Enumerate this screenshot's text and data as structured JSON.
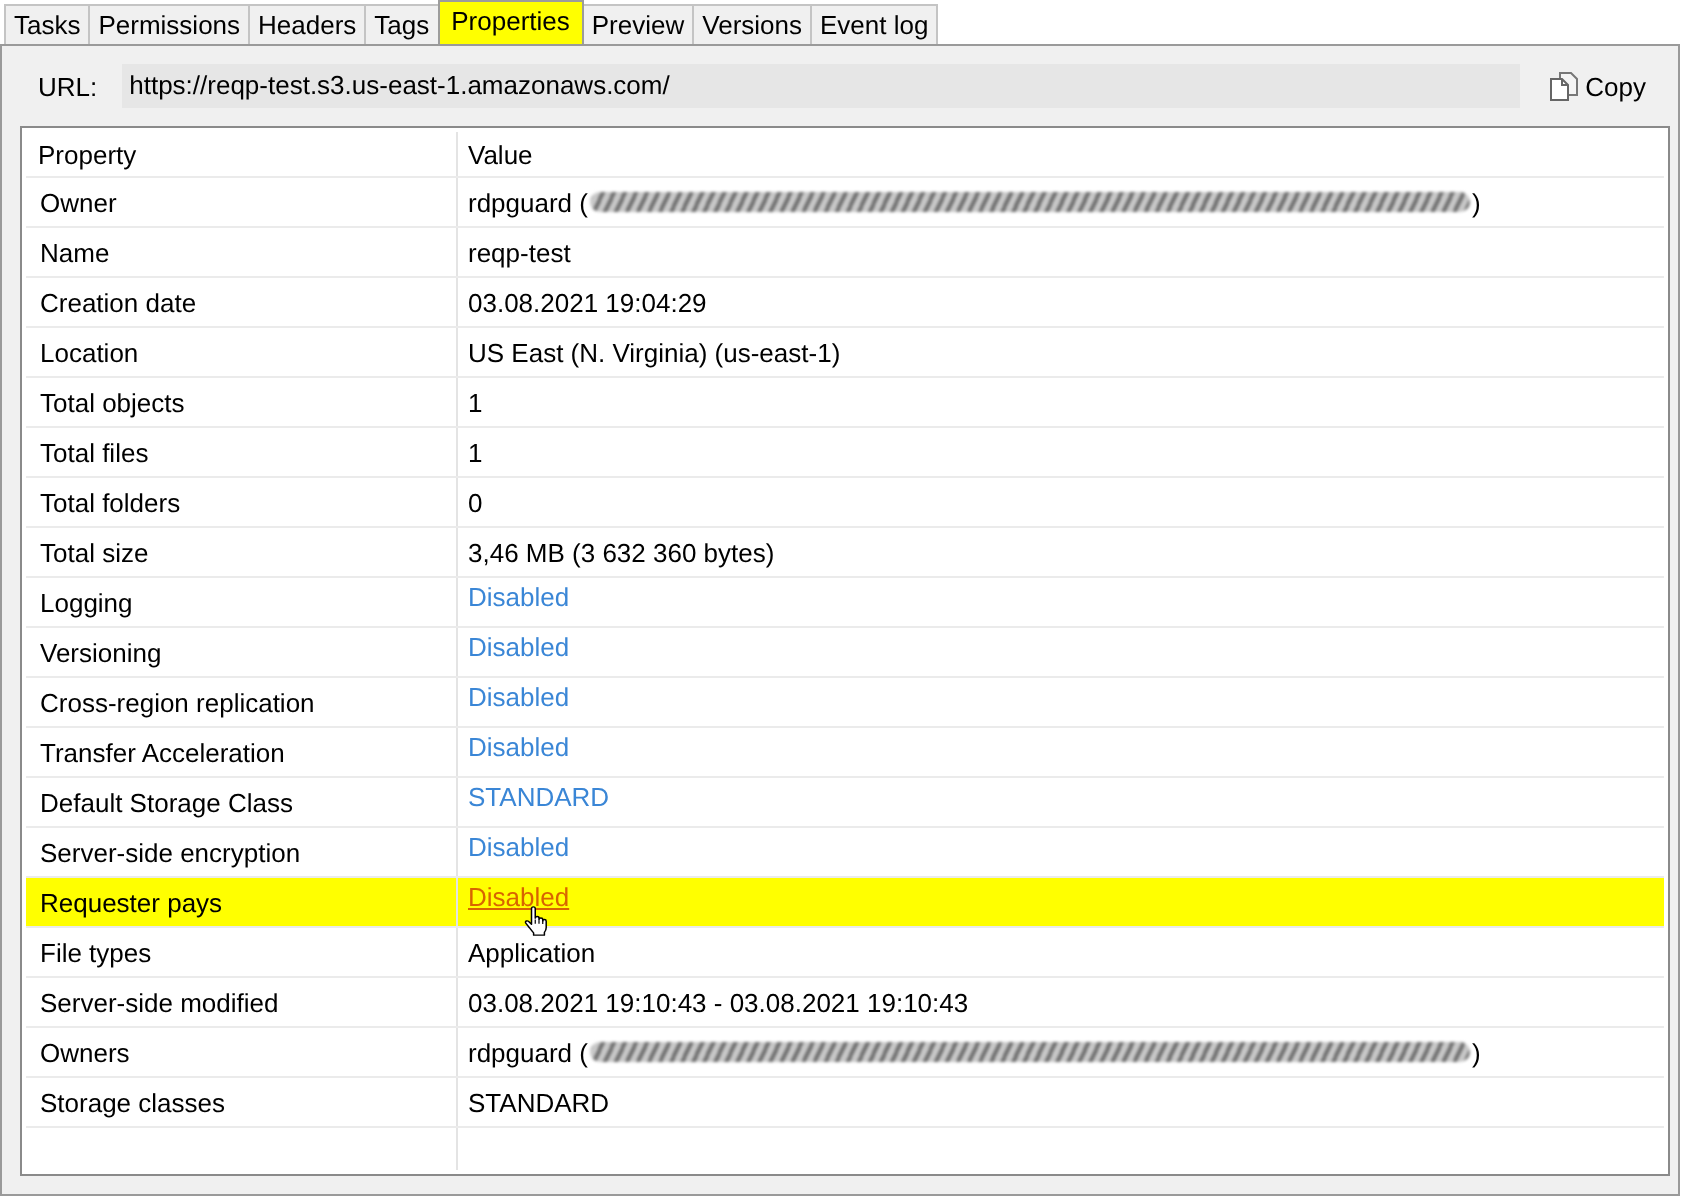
{
  "tabs": [
    {
      "label": "Tasks",
      "selected": false
    },
    {
      "label": "Permissions",
      "selected": false
    },
    {
      "label": "Headers",
      "selected": false
    },
    {
      "label": "Tags",
      "selected": false
    },
    {
      "label": "Properties",
      "selected": true
    },
    {
      "label": "Preview",
      "selected": false
    },
    {
      "label": "Versions",
      "selected": false
    },
    {
      "label": "Event log",
      "selected": false
    }
  ],
  "url_bar": {
    "label": "URL:",
    "value": "https://reqp-test.s3.us-east-1.amazonaws.com/",
    "copy_button": "Copy"
  },
  "table": {
    "columns": [
      "Property",
      "Value"
    ],
    "rows": [
      {
        "property": "Owner",
        "kind": "redacted",
        "value": "rdpguard (",
        "value_end": ")",
        "selected": false,
        "hovered": false
      },
      {
        "property": "Name",
        "kind": "text",
        "value": "reqp-test",
        "selected": false,
        "hovered": false
      },
      {
        "property": "Creation date",
        "kind": "text",
        "value": "03.08.2021 19:04:29",
        "selected": false,
        "hovered": false
      },
      {
        "property": "Location",
        "kind": "text",
        "value": "US East (N. Virginia) (us-east-1)",
        "selected": false,
        "hovered": false
      },
      {
        "property": "Total objects",
        "kind": "text",
        "value": "1",
        "selected": false,
        "hovered": false
      },
      {
        "property": "Total files",
        "kind": "text",
        "value": "1",
        "selected": false,
        "hovered": false
      },
      {
        "property": "Total folders",
        "kind": "text",
        "value": "0",
        "selected": false,
        "hovered": false
      },
      {
        "property": "Total size",
        "kind": "text",
        "value": "3,46 MB (3 632 360 bytes)",
        "selected": false,
        "hovered": false
      },
      {
        "property": "Logging",
        "kind": "link",
        "value": "Disabled",
        "selected": false,
        "hovered": false
      },
      {
        "property": "Versioning",
        "kind": "link",
        "value": "Disabled",
        "selected": false,
        "hovered": false
      },
      {
        "property": "Cross-region replication",
        "kind": "link",
        "value": "Disabled",
        "selected": false,
        "hovered": false
      },
      {
        "property": "Transfer Acceleration",
        "kind": "link",
        "value": "Disabled",
        "selected": false,
        "hovered": false
      },
      {
        "property": "Default Storage Class",
        "kind": "link",
        "value": "STANDARD",
        "selected": false,
        "hovered": false
      },
      {
        "property": "Server-side encryption",
        "kind": "link",
        "value": "Disabled",
        "selected": false,
        "hovered": false
      },
      {
        "property": "Requester pays",
        "kind": "link",
        "value": "Disabled",
        "selected": true,
        "hovered": true
      },
      {
        "property": "File types",
        "kind": "text",
        "value": "Application",
        "selected": false,
        "hovered": false
      },
      {
        "property": "Server-side modified",
        "kind": "text",
        "value": "03.08.2021 19:10:43 - 03.08.2021 19:10:43",
        "selected": false,
        "hovered": false
      },
      {
        "property": "Owners",
        "kind": "redacted",
        "value": "rdpguard (",
        "value_end": ")",
        "selected": false,
        "hovered": false
      },
      {
        "property": "Storage classes",
        "kind": "text",
        "value": "STANDARD",
        "selected": false,
        "hovered": false
      }
    ]
  }
}
